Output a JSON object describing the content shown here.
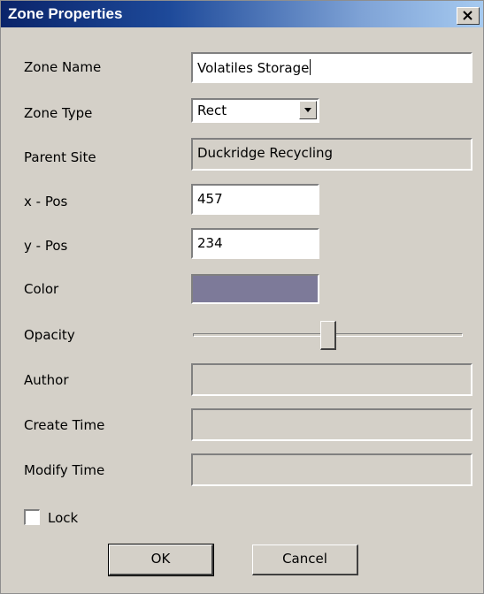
{
  "window": {
    "title": "Zone Properties"
  },
  "fields": {
    "zone_name": {
      "label": "Zone Name",
      "value": "Volatiles Storage"
    },
    "zone_type": {
      "label": "Zone Type",
      "value": "Rect"
    },
    "parent_site": {
      "label": "Parent Site",
      "value": "Duckridge Recycling"
    },
    "x_pos": {
      "label": "x - Pos",
      "value": "457"
    },
    "y_pos": {
      "label": "y - Pos",
      "value": "234"
    },
    "color": {
      "label": "Color",
      "swatch": "#7d7a99"
    },
    "opacity": {
      "label": "Opacity",
      "fraction": 0.5
    },
    "author": {
      "label": "Author",
      "value": ""
    },
    "create_time": {
      "label": "Create Time",
      "value": ""
    },
    "modify_time": {
      "label": "Modify Time",
      "value": ""
    },
    "lock": {
      "label": "Lock",
      "checked": false
    }
  },
  "buttons": {
    "ok": "OK",
    "cancel": "Cancel"
  },
  "icons": {
    "close": "close-icon",
    "dropdown": "chevron-down-icon"
  },
  "colors": {
    "title_start": "#0a246a",
    "title_end": "#a6caf0",
    "face": "#d4d0c8"
  }
}
